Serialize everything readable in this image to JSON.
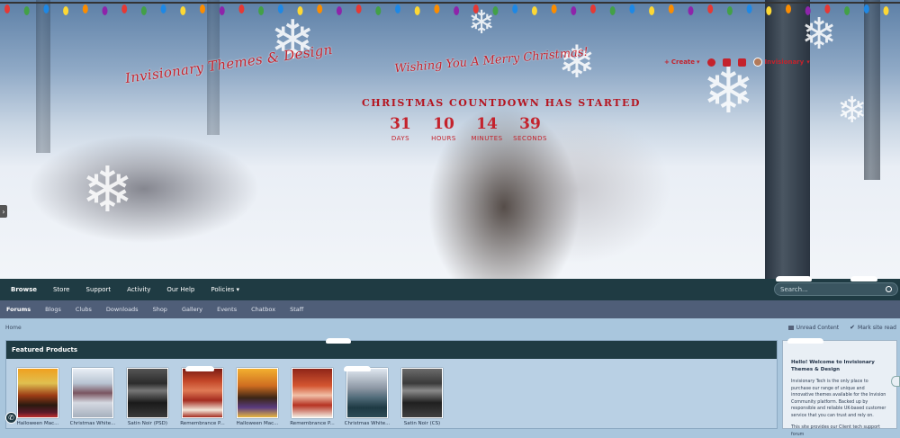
{
  "hero": {
    "site_title": "Invisionary Themes & Design",
    "greeting": "Wishing You A Merry Christmas!",
    "countdown_title": "CHRISTMAS COUNTDOWN HAS STARTED",
    "countdown": [
      {
        "value": "31",
        "label": "DAYS"
      },
      {
        "value": "10",
        "label": "HOURS"
      },
      {
        "value": "14",
        "label": "MINUTES"
      },
      {
        "value": "39",
        "label": "SECONDS"
      }
    ]
  },
  "user_bar": {
    "create_label": "Create",
    "username": "Invisionary"
  },
  "primary_nav": {
    "items": [
      "Browse",
      "Store",
      "Support",
      "Activity",
      "Our Help",
      "Policies"
    ],
    "search_placeholder": "Search..."
  },
  "secondary_nav": {
    "items": [
      "Forums",
      "Blogs",
      "Clubs",
      "Downloads",
      "Shop",
      "Gallery",
      "Events",
      "Chatbox",
      "Staff"
    ]
  },
  "breadcrumb": "Home",
  "page_actions": {
    "unread": "Unread Content",
    "mark_read": "Mark site read"
  },
  "featured": {
    "title": "Featured Products",
    "products": [
      {
        "name": "Halloween Mac..."
      },
      {
        "name": "Christmas White..."
      },
      {
        "name": "Satin Noir (PSD)"
      },
      {
        "name": "Remembrance P..."
      },
      {
        "name": "Halloween Mac..."
      },
      {
        "name": "Remembrance P..."
      },
      {
        "name": "Christmas White..."
      },
      {
        "name": "Satin Noir (CS)"
      }
    ]
  },
  "sidebar": {
    "title": "Hello! Welcome to Invisionary Themes & Design",
    "text1": "Invisionary Tech is the only place to purchase our range of unique and innovative themes available for the Invision Community platform. Backed up by responsible and reliable UK-based customer service that you can trust and rely on.",
    "text2": "This site provides our Client tech support forum"
  },
  "colors": {
    "accent_red": "#c4222c",
    "nav_dark": "#1f3b43",
    "subnav": "#4f5e78",
    "content_bg": "#a9c6dd"
  }
}
